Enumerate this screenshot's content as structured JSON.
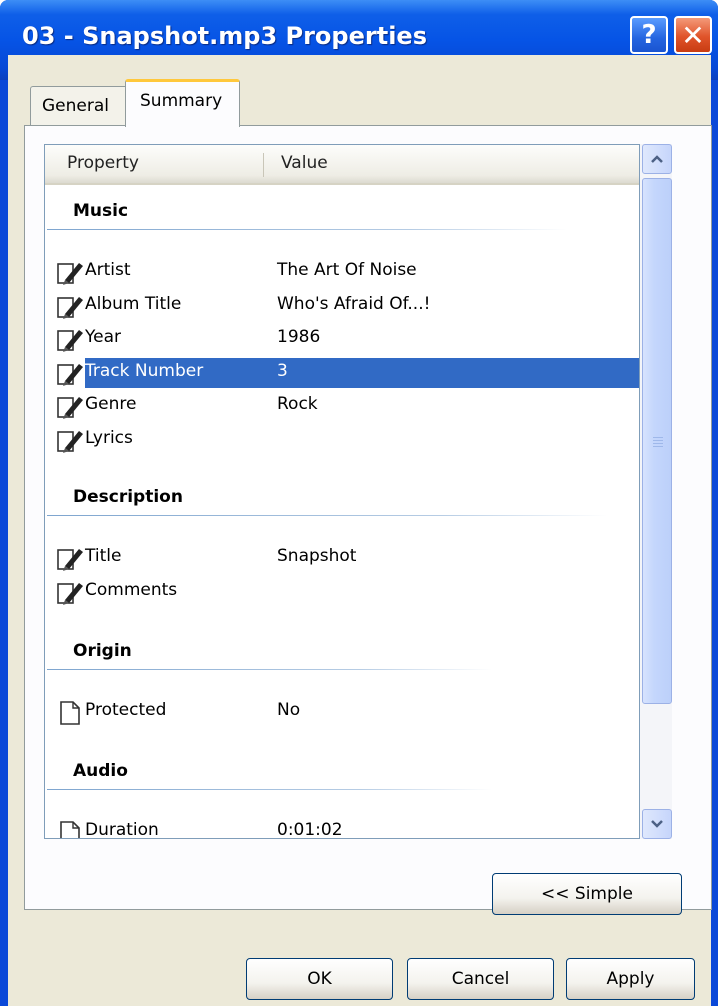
{
  "window": {
    "title": "03 - Snapshot.mp3 Properties",
    "help_glyph": "?",
    "close_glyph": "✕"
  },
  "tabs": [
    {
      "label": "General",
      "active": false
    },
    {
      "label": "Summary",
      "active": true
    }
  ],
  "listview": {
    "columns": [
      "Property",
      "Value"
    ],
    "groups": [
      {
        "label": "Music",
        "rows": [
          {
            "name": "Artist",
            "value": "The Art Of Noise",
            "icon": "edit-pencil-icon"
          },
          {
            "name": "Album Title",
            "value": "Who's Afraid Of...!",
            "icon": "edit-pencil-icon"
          },
          {
            "name": "Year",
            "value": "1986",
            "icon": "edit-pencil-icon"
          },
          {
            "name": "Track Number",
            "value": "3",
            "icon": "edit-pencil-icon",
            "selected": true
          },
          {
            "name": "Genre",
            "value": "Rock",
            "icon": "edit-pencil-icon"
          },
          {
            "name": "Lyrics",
            "value": "",
            "icon": "edit-pencil-icon"
          }
        ]
      },
      {
        "label": "Description",
        "rows": [
          {
            "name": "Title",
            "value": "Snapshot",
            "icon": "edit-pencil-icon"
          },
          {
            "name": "Comments",
            "value": "",
            "icon": "edit-pencil-icon"
          }
        ]
      },
      {
        "label": "Origin",
        "rows": [
          {
            "name": "Protected",
            "value": "No",
            "icon": "document-icon"
          }
        ]
      },
      {
        "label": "Audio",
        "rows": [
          {
            "name": "Duration",
            "value": "0:01:02",
            "icon": "document-icon"
          }
        ]
      }
    ]
  },
  "buttons": {
    "simple": "<< Simple",
    "ok": "OK",
    "cancel": "Cancel",
    "apply": "Apply"
  },
  "colors": {
    "titlebar": "#0654e6",
    "selection": "#316ac5",
    "face": "#ece9d8"
  }
}
